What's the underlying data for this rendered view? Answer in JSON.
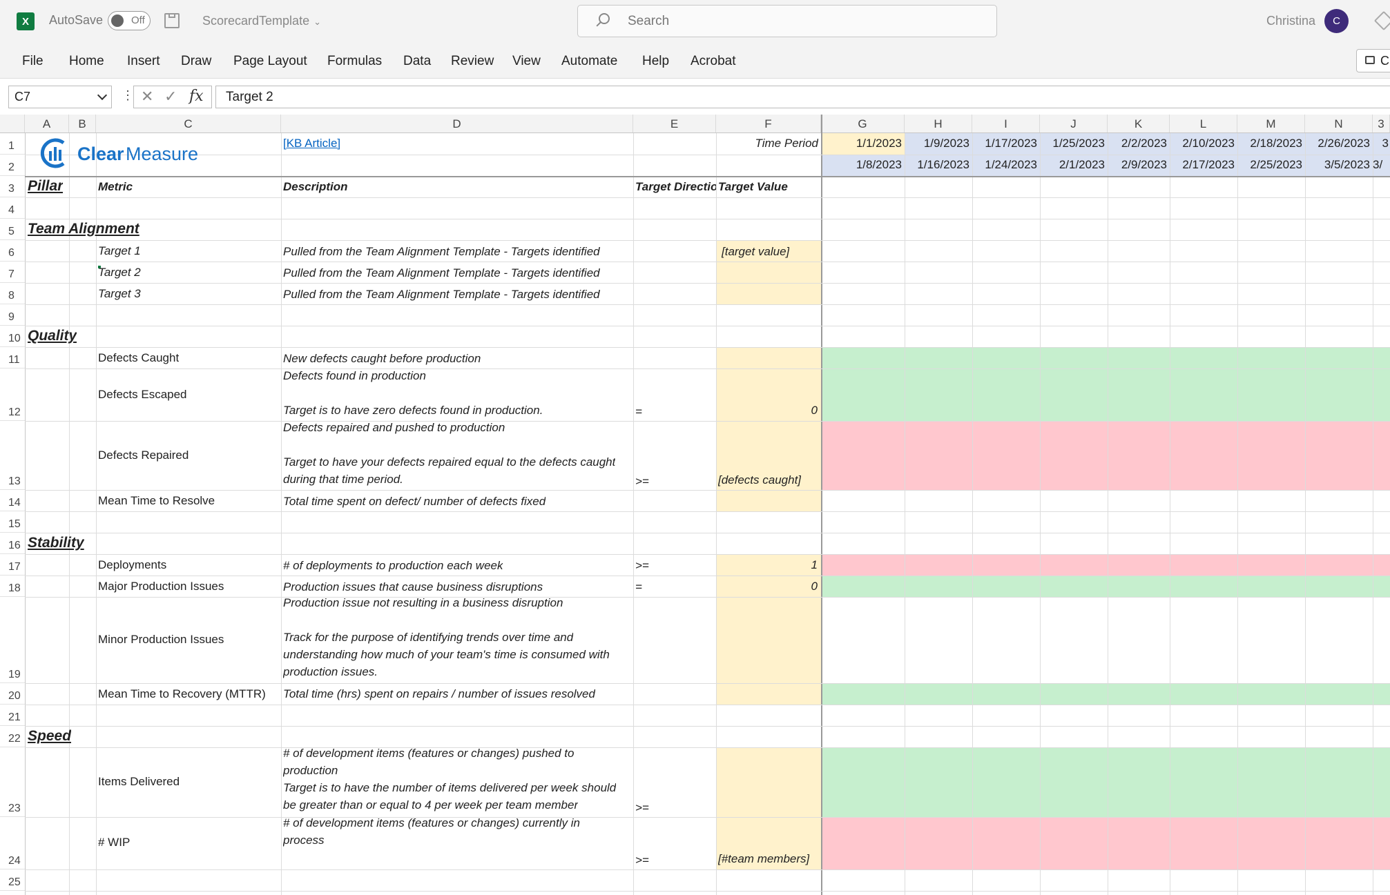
{
  "titlebar": {
    "app_icon": "excel-icon",
    "autosave_label": "AutoSave",
    "autosave_state": "Off",
    "doc_name": "ScorecardTemplate",
    "search_placeholder": "Search",
    "user_name": "Christina",
    "avatar_initial": "C"
  },
  "menu": [
    "File",
    "Home",
    "Insert",
    "Draw",
    "Page Layout",
    "Formulas",
    "Data",
    "Review",
    "View",
    "Automate",
    "Help",
    "Acrobat"
  ],
  "comments_label": "C",
  "formula_bar": {
    "name_box": "C7",
    "formula": "Target 2"
  },
  "columns": [
    "A",
    "B",
    "C",
    "D",
    "E",
    "F",
    "G",
    "H",
    "I",
    "J",
    "K",
    "L",
    "M",
    "N",
    "3"
  ],
  "colors": {
    "target_fill": "#fff2cc",
    "date_start_fill": "#fff2cc",
    "date_fill": "#d9e1f2",
    "green_fill": "#c6efce",
    "red_fill": "#ffc7ce",
    "brand_blue": "#1a73c7"
  },
  "logo": {
    "clear": "Clear",
    "measure": "Measure"
  },
  "header": {
    "kb_link": "[KB Article]",
    "time_period": "Time Period",
    "start_dates": [
      "1/1/2023",
      "1/9/2023",
      "1/17/2023",
      "1/25/2023",
      "2/2/2023",
      "2/10/2023",
      "2/18/2023",
      "2/26/2023",
      "3"
    ],
    "end_dates": [
      "1/8/2023",
      "1/16/2023",
      "1/24/2023",
      "2/1/2023",
      "2/9/2023",
      "2/17/2023",
      "2/25/2023",
      "3/5/2023",
      "3/"
    ],
    "pillar": "Pillar",
    "metric": "Metric",
    "description": "Description",
    "target_direction": "Target Directio",
    "target_value": "Target Value"
  },
  "sections": {
    "team_alignment": "Team Alignment",
    "quality": "Quality",
    "stability": "Stability",
    "speed": "Speed"
  },
  "rows": {
    "r6": {
      "metric": "Target 1",
      "desc": "Pulled from the Team Alignment Template - Targets identified",
      "value": "[target value]"
    },
    "r7": {
      "metric": "Target 2",
      "desc": "Pulled from the Team Alignment Template - Targets identified"
    },
    "r8": {
      "metric": "Target 3",
      "desc": "Pulled from the Team Alignment Template - Targets identified"
    },
    "r11": {
      "metric": "Defects Caught",
      "desc": "New defects caught before production"
    },
    "r12": {
      "metric": "Defects Escaped",
      "desc1": "Defects found in production",
      "desc2": "Target is to have zero defects found in production.",
      "dir": "=",
      "value": "0"
    },
    "r13": {
      "metric": "Defects Repaired",
      "desc1": "Defects repaired and pushed to production",
      "desc2": "Target to have your defects repaired equal to the defects caught",
      "desc3": "during that time period.",
      "dir": ">=",
      "value": "[defects caught]"
    },
    "r14": {
      "metric": "Mean Time to Resolve",
      "desc": "Total time spent on defect/ number of defects fixed"
    },
    "r17": {
      "metric": "Deployments",
      "desc": "# of deployments to production each week",
      "dir": ">=",
      "value": "1"
    },
    "r18": {
      "metric": "Major Production Issues",
      "desc": "Production issues that cause business disruptions",
      "dir": "=",
      "value": "0"
    },
    "r19": {
      "metric": "Minor Production Issues",
      "desc1": "Production issue not resulting in a business disruption",
      "desc2": "Track for the purpose of identifying trends over time and",
      "desc3": "understanding how much of your team's time is consumed with",
      "desc4": "production issues."
    },
    "r20": {
      "metric": "Mean Time to Recovery (MTTR)",
      "desc": "Total time (hrs) spent on repairs / number of issues resolved"
    },
    "r23": {
      "metric": "Items Delivered",
      "desc1": "# of development items (features or changes) pushed to",
      "desc2": "production",
      "desc3": "Target is to have the number of items delivered per week should",
      "desc4": "be greater than or equal to 4 per week per team member",
      "dir": ">="
    },
    "r24": {
      "metric": "# WIP",
      "desc1": "# of development items (features or changes) currently in",
      "desc2": "process",
      "dir": ">=",
      "value": "[#team members]"
    }
  },
  "row_numbers": [
    "1",
    "2",
    "3",
    "4",
    "5",
    "6",
    "7",
    "8",
    "9",
    "10",
    "11",
    "12",
    "13",
    "14",
    "15",
    "16",
    "17",
    "18",
    "19",
    "20",
    "21",
    "22",
    "23",
    "24",
    "25"
  ]
}
